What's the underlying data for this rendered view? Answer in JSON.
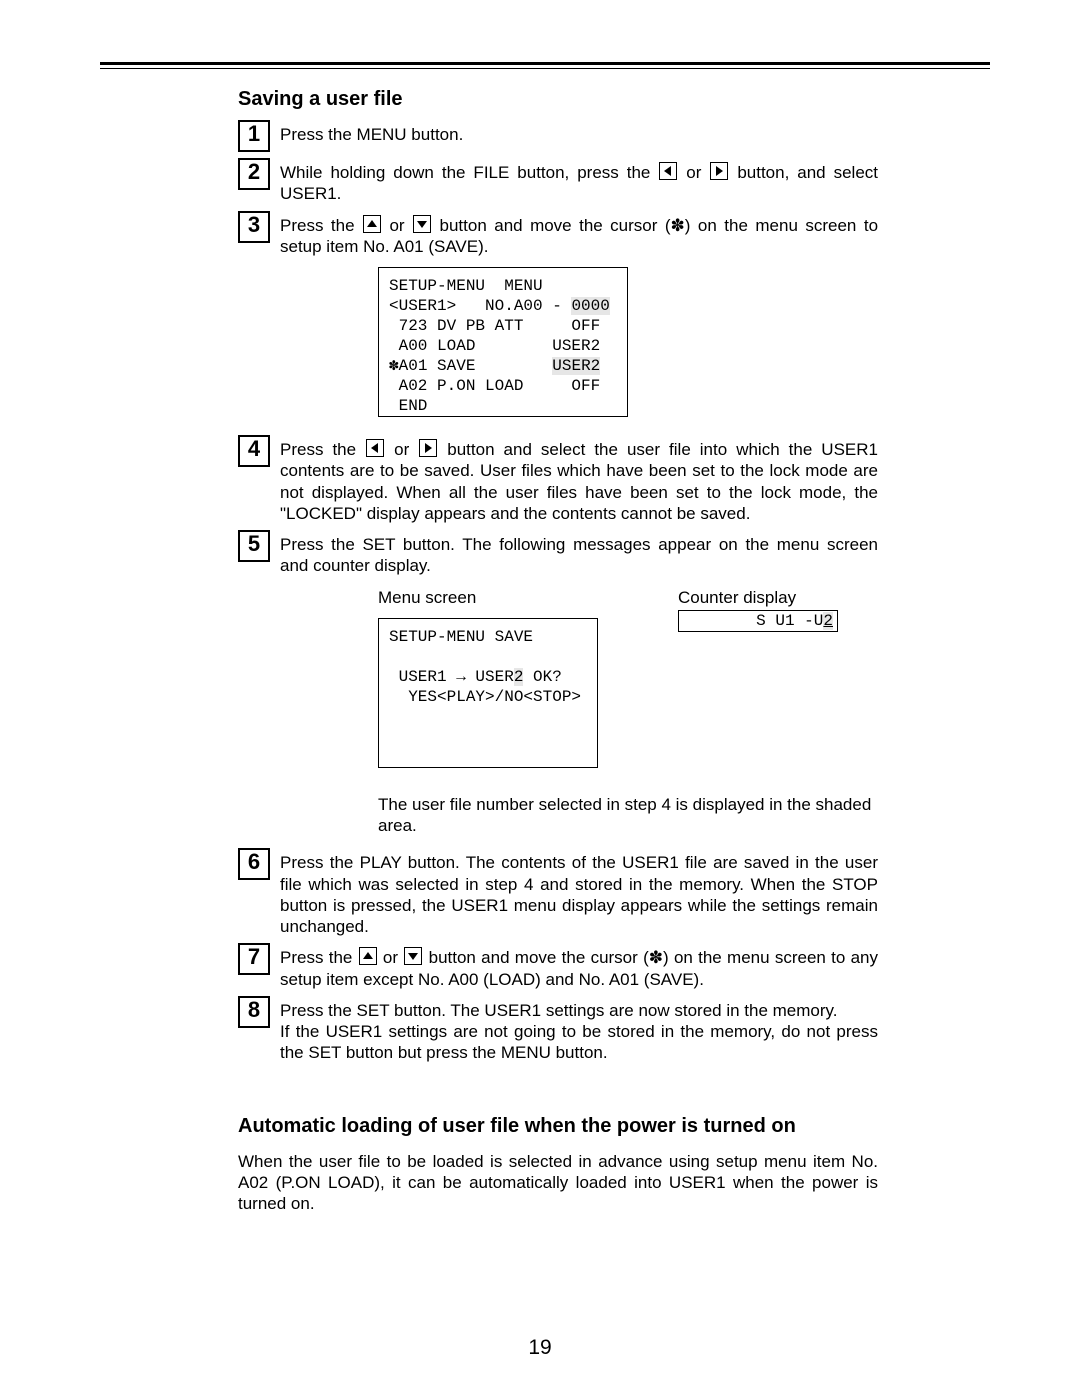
{
  "section1_title": "Saving a user file",
  "steps": {
    "s1": {
      "num": "1",
      "text_a": "Press the MENU button."
    },
    "s2": {
      "num": "2",
      "text_a": "While holding down the FILE button, press the ",
      "text_b": " or ",
      "text_c": " button, and select USER1."
    },
    "s3": {
      "num": "3",
      "text_a": "Press the ",
      "text_b": " or ",
      "text_c": " button and move the cursor (",
      "cursor": "✽",
      "text_d": ") on the menu screen to setup item No. A01 (SAVE)."
    },
    "s4": {
      "num": "4",
      "text_a": "Press the ",
      "text_b": " or ",
      "text_c": " button and select the user file into which the USER1 contents are to be saved. User files which have been set to the lock mode are not displayed. When all the user files have been set to the lock mode, the \"LOCKED\" display appears and the contents cannot be saved."
    },
    "s5": {
      "num": "5",
      "text_a": "Press the SET button. The following messages appear on the menu screen and counter display."
    },
    "s6": {
      "num": "6",
      "text_a": "Press the PLAY button. The contents of the USER1 file are saved in the user file which was selected in step 4 and stored in the memory. When the STOP button is pressed, the USER1 menu display appears while the settings remain unchanged."
    },
    "s7": {
      "num": "7",
      "text_a": "Press the ",
      "text_b": " or ",
      "text_c": " button and move the cursor (",
      "cursor": "✽",
      "text_d": ") on the menu screen to any setup item except No. A00 (LOAD) and No. A01 (SAVE)."
    },
    "s8": {
      "num": "8",
      "line1": "Press the SET button. The USER1 settings are now stored in the memory.",
      "line2": "If the USER1 settings are not going to be stored in the memory, do not press the SET button but press the MENU button."
    }
  },
  "menu1": {
    "l1": "SETUP-MENU  MENU",
    "l2_a": "<USER1>   NO.A00 - ",
    "l2_b": "0000",
    "l3": " 723 DV PB ATT     OFF",
    "l4": " A00 LOAD        USER2",
    "l5_a": "✽A01 SAVE        ",
    "l5_b": "USER2",
    "l6": " A02 P.ON LOAD     OFF",
    "l7": " END"
  },
  "screens_labels": {
    "menu": "Menu screen",
    "counter": "Counter display"
  },
  "menu2": {
    "l1": "SETUP-MENU SAVE",
    "l2": "",
    "l3_a": " USER1 → USER",
    "l3_b": "2",
    "l3_c": " OK?",
    "l4": "  YES<PLAY>/NO<STOP>"
  },
  "counter": {
    "pre": "S U1 -U",
    "shaded": "2"
  },
  "caption_step5": "The user file number selected in step 4 is displayed in the shaded area.",
  "section2_title": "Automatic loading of user file when the power is turned on",
  "section2_body": "When the user file to be loaded is selected in advance using setup menu item No. A02 (P.ON LOAD), it can be automatically loaded into USER1 when the power is turned on.",
  "page_number": "19"
}
